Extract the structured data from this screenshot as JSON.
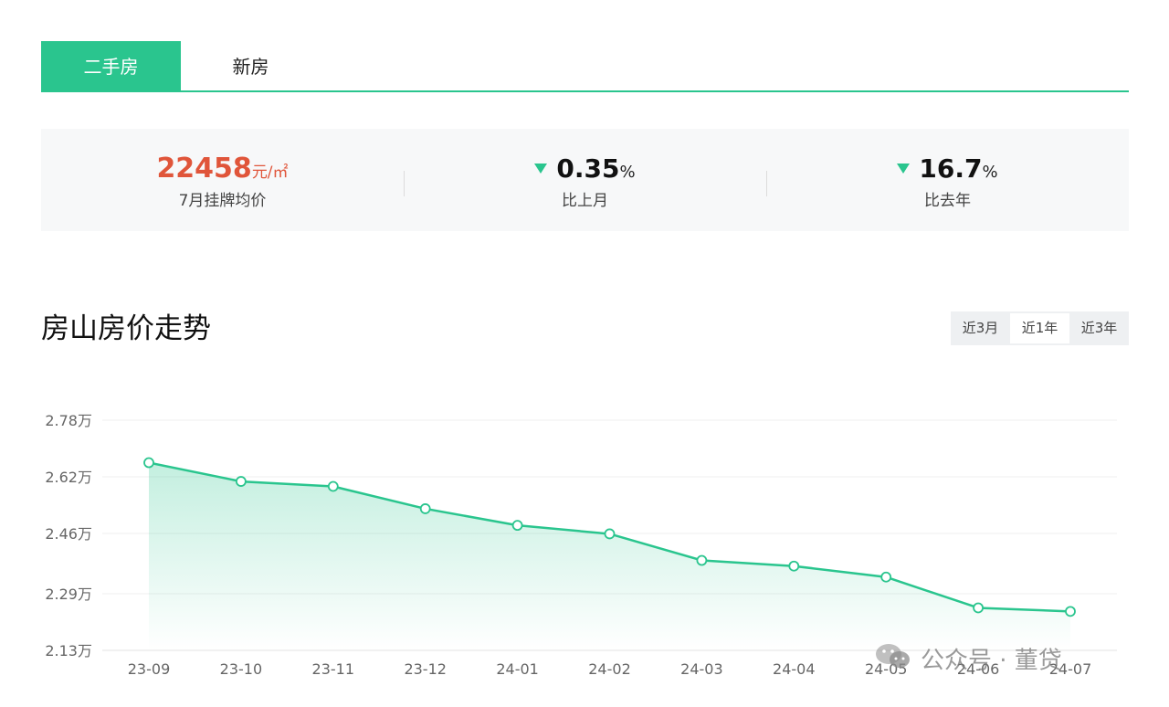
{
  "tabs": [
    {
      "label": "二手房",
      "active": true
    },
    {
      "label": "新房",
      "active": false
    }
  ],
  "stats": {
    "price": {
      "value": "22458",
      "unit": "元/㎡",
      "label": "7月挂牌均价"
    },
    "mom": {
      "value": "0.35",
      "pct": "%",
      "label": "比上月",
      "direction": "down"
    },
    "yoy": {
      "value": "16.7",
      "pct": "%",
      "label": "比去年",
      "direction": "down"
    }
  },
  "title": "房山房价走势",
  "ranges": [
    {
      "label": "近3月",
      "active": false
    },
    {
      "label": "近1年",
      "active": true
    },
    {
      "label": "近3年",
      "active": false
    }
  ],
  "colors": {
    "accent": "#2ac58e",
    "price": "#e0553a"
  },
  "watermark": "公众号 · 董贷",
  "chart_data": {
    "type": "area",
    "categories": [
      "23-09",
      "23-10",
      "23-11",
      "23-12",
      "24-01",
      "24-02",
      "24-03",
      "24-04",
      "24-05",
      "24-06",
      "24-07"
    ],
    "values": [
      2.66,
      2.607,
      2.593,
      2.53,
      2.483,
      2.459,
      2.384,
      2.368,
      2.337,
      2.25,
      2.24
    ],
    "yticks": [
      "2.78万",
      "2.62万",
      "2.46万",
      "2.29万",
      "2.13万"
    ],
    "ytick_values": [
      2.78,
      2.62,
      2.46,
      2.29,
      2.13
    ],
    "ylim": [
      2.13,
      2.78
    ],
    "grid": true
  }
}
